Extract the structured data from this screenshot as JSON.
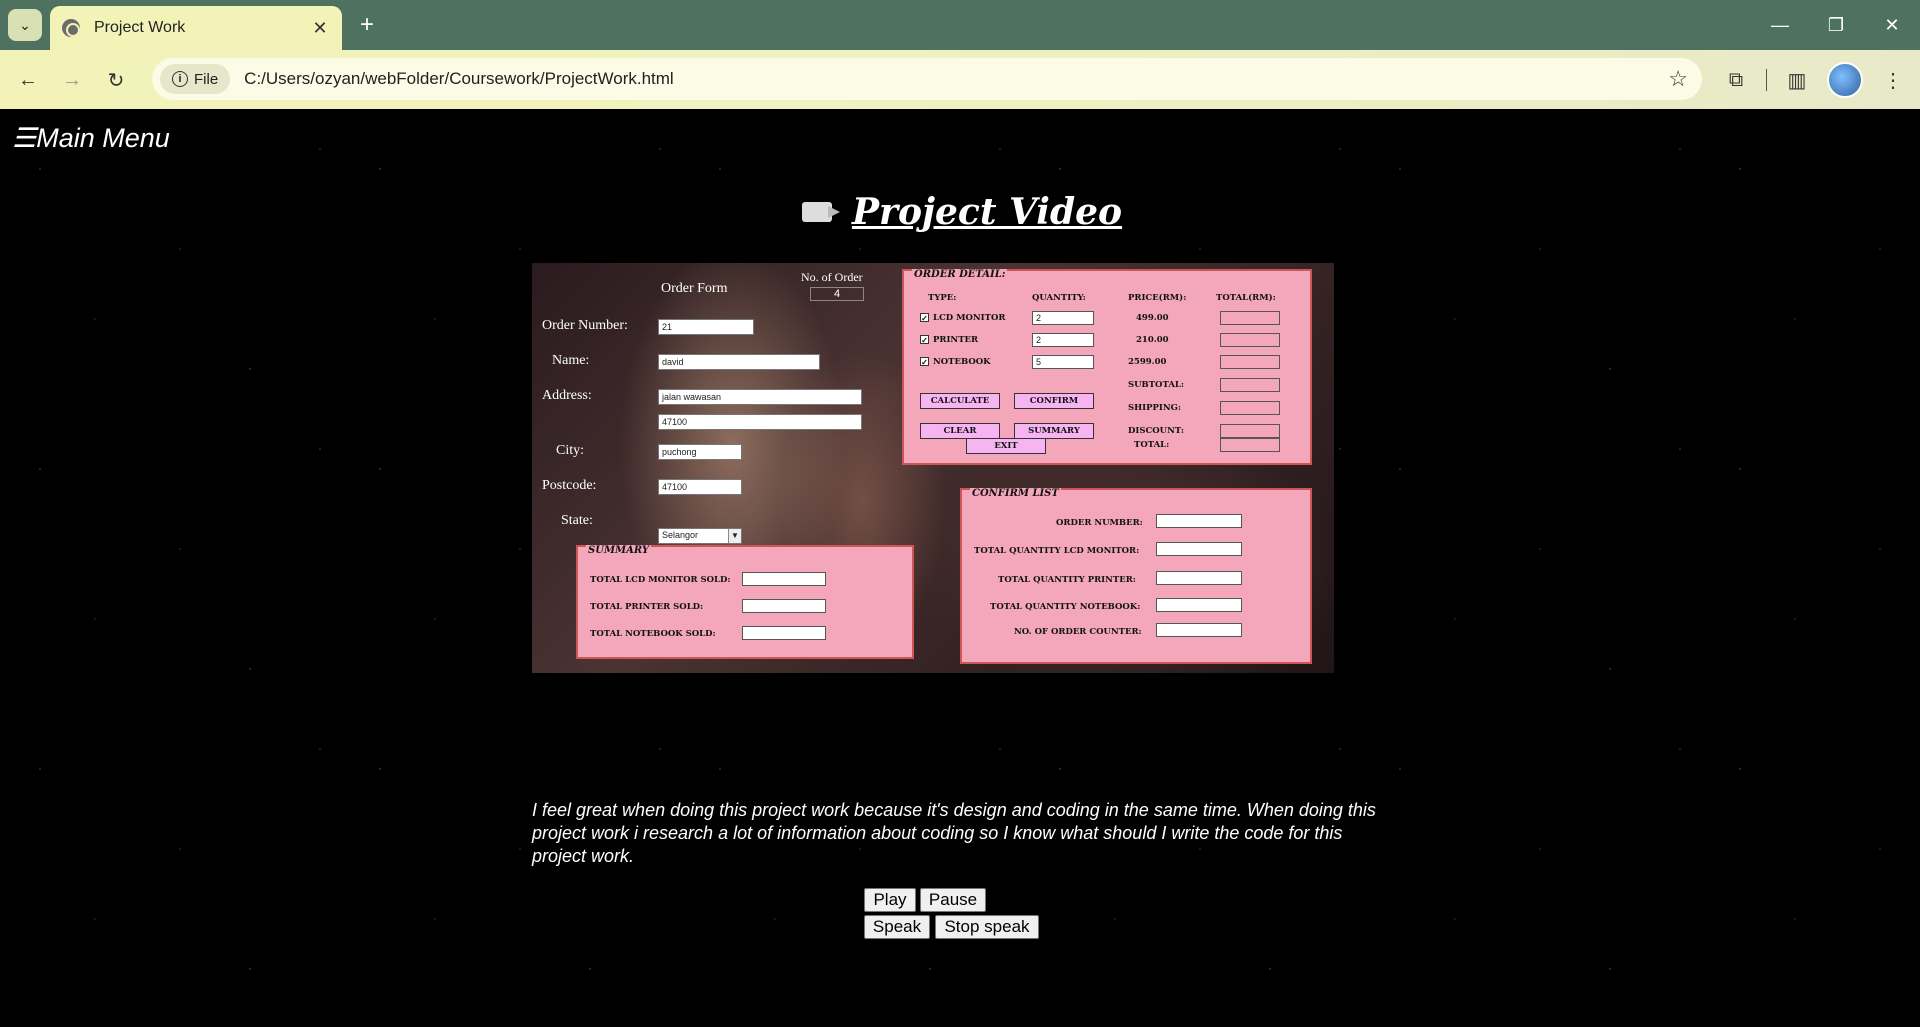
{
  "browser": {
    "tab_title": "Project Work",
    "url_chip": "File",
    "url": "C:/Users/ozyan/webFolder/Coursework/ProjectWork.html"
  },
  "page": {
    "main_menu": "☰Main Menu",
    "title": "Project Video",
    "description": "I feel great when doing this project work because it's design and coding in the same time. When doing this project work i research a lot of information about coding so I know what should I write the code for this project work.",
    "buttons": {
      "play": "Play",
      "pause": "Pause",
      "speak": "Speak",
      "stop_speak": "Stop speak"
    }
  },
  "order_form": {
    "heading": "Order Form",
    "order_count_label": "No. of Order",
    "order_count_value": "4",
    "labels": {
      "order_number": "Order Number:",
      "name": "Name:",
      "address": "Address:",
      "city": "City:",
      "postcode": "Postcode:",
      "state": "State:"
    },
    "values": {
      "order_number": "21",
      "name": "david",
      "address1": "jalan wawasan",
      "address2": "47100",
      "city": "puchong",
      "postcode": "47100",
      "state": "Selangor"
    },
    "summary": {
      "legend": "SUMMARY",
      "lcd": "TOTAL LCD MONITOR SOLD:",
      "printer": "TOTAL PRINTER SOLD:",
      "notebook": "TOTAL NOTEBOOK SOLD:"
    },
    "order_detail": {
      "legend": "ORDER DETAIL:",
      "headers": [
        "TYPE:",
        "QUANTITY:",
        "PRICE(RM):",
        "TOTAL(RM):"
      ],
      "items": [
        {
          "name": "LCD MONITOR",
          "checked": "✓",
          "qty": "2",
          "price": "499.00"
        },
        {
          "name": "PRINTER",
          "checked": "✓",
          "qty": "2",
          "price": "210.00"
        },
        {
          "name": "NOTEBOOK",
          "checked": "✓",
          "qty": "5",
          "price": "2599.00"
        }
      ],
      "subtotal": "SUBTOTAL:",
      "shipping": "SHIPPING:",
      "discount": "DISCOUNT:",
      "total": "TOTAL:",
      "btn_calculate": "CALCULATE",
      "btn_confirm": "CONFIRM",
      "btn_clear": "CLEAR",
      "btn_summary": "SUMMARY",
      "btn_exit": "EXIT"
    },
    "confirm_list": {
      "legend": "CONFIRM LIST",
      "order_number": "ORDER NUMBER:",
      "total_lcd": "TOTAL QUANTITY LCD MONITOR:",
      "total_printer": "TOTAL QUANTITY PRINTER:",
      "total_notebook": "TOTAL QUANTITY NOTEBOOK:",
      "order_counter": "NO. OF ORDER COUNTER:"
    }
  }
}
